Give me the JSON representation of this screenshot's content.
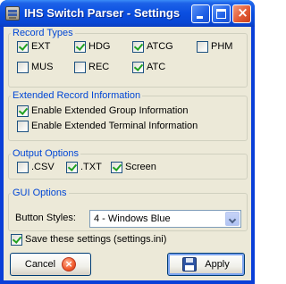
{
  "window": {
    "title": "IHS Switch Parser - Settings",
    "controls": {
      "minimize": "_",
      "maximize": "□",
      "close": "×"
    }
  },
  "record_types": {
    "title": "Record Types",
    "items": [
      {
        "label": "EXT",
        "checked": true
      },
      {
        "label": "HDG",
        "checked": true
      },
      {
        "label": "ATCG",
        "checked": true
      },
      {
        "label": "PHM",
        "checked": false
      },
      {
        "label": "MUS",
        "checked": false
      },
      {
        "label": "REC",
        "checked": false
      },
      {
        "label": "ATC",
        "checked": true
      }
    ]
  },
  "extended_info": {
    "title": "Extended Record Information",
    "items": [
      {
        "label": "Enable Extended Group Information",
        "checked": true
      },
      {
        "label": "Enable Extended Terminal Information",
        "checked": false
      }
    ]
  },
  "output_options": {
    "title": "Output Options",
    "items": [
      {
        "label": ".CSV",
        "checked": false
      },
      {
        "label": ".TXT",
        "checked": true
      },
      {
        "label": "Screen",
        "checked": true
      }
    ]
  },
  "gui_options": {
    "title": "GUI Options",
    "button_styles_label": "Button Styles:",
    "button_styles_value": "4 - Windows Blue"
  },
  "save_settings": {
    "label": "Save these settings (settings.ini)",
    "checked": true
  },
  "buttons": {
    "cancel": "Cancel",
    "apply": "Apply"
  },
  "icons": {
    "app": "app-icon",
    "cancel": "cancel-icon",
    "apply": "floppy-disk-icon",
    "dropdown": "chevron-down-icon",
    "check": "checkmark-icon"
  },
  "colors": {
    "titlebar": "#0a4ee0",
    "group_title": "#0046d5",
    "dialog_background": "#ece9d8",
    "checkmark": "#21a121"
  }
}
